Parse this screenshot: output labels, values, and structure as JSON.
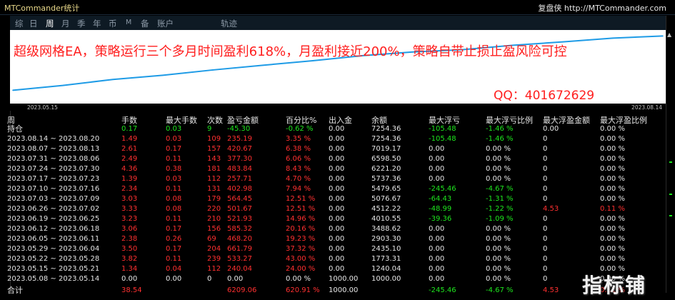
{
  "window": {
    "title": "MTCommander统计",
    "brand": "复盘侠 http://MTCommander.com"
  },
  "tabs": [
    "综",
    "日",
    "周",
    "月",
    "季",
    "年",
    "币",
    "M",
    "备",
    "账户",
    "轨迹"
  ],
  "active_tab": "周",
  "chart": {
    "headline": "超级网格EA，策略运行三个多月时间盈利618%，月盈利接近200%，策略自带止损止盈风险可控",
    "qq": "QQ：401672629",
    "start_date": "2023.05.15",
    "end_date": "2023.08.14",
    "line_color": "#1e9be6",
    "background": "#ffffff"
  },
  "chart_data": {
    "type": "line",
    "x": [
      "2023.05.15",
      "2023.05.22",
      "2023.05.29",
      "2023.06.05",
      "2023.06.12",
      "2023.06.19",
      "2023.06.26",
      "2023.07.03",
      "2023.07.10",
      "2023.07.17",
      "2023.07.24",
      "2023.07.31",
      "2023.08.07",
      "2023.08.14"
    ],
    "series": [
      {
        "values": [
          1240.04,
          1773.31,
          2435.1,
          2903.3,
          3488.62,
          4010.55,
          4512.22,
          5076.67,
          5479.65,
          5737.36,
          6221.2,
          6598.5,
          7019.17,
          7254.36
        ]
      }
    ]
  },
  "table": {
    "headers": [
      "周",
      "手数",
      "最大手数",
      "次数",
      "盈亏金额",
      "百分比%",
      "出入金",
      "余额",
      "最大浮亏",
      "最大浮亏比例",
      "最大浮盈金额",
      "最大浮盈比例"
    ],
    "holding_label": "持仓",
    "holding": [
      "0.17",
      "0.03",
      "9",
      "-45.30",
      "-0.62 %",
      "0.00",
      "7254.36",
      "-105.48",
      "-1.46 %",
      "0.00",
      "0.00 %"
    ],
    "rows": [
      [
        "2023.08.14 ~ 2023.08.20",
        "1.49",
        "0.03",
        "109",
        "235.19",
        "3.35 %",
        "0.00",
        "7254.36",
        "-105.48",
        "-1.46 %",
        "0",
        "0.00 %"
      ],
      [
        "2023.08.07 ~ 2023.08.13",
        "2.61",
        "0.17",
        "157",
        "420.67",
        "6.38 %",
        "0.00",
        "7019.17",
        "0.00",
        "0.00 %",
        "0",
        "0.00 %"
      ],
      [
        "2023.07.31 ~ 2023.08.06",
        "2.49",
        "0.11",
        "143",
        "377.30",
        "6.06 %",
        "0.00",
        "6598.50",
        "0.00",
        "0.00 %",
        "0",
        "0.00 %"
      ],
      [
        "2023.07.24 ~ 2023.07.30",
        "4.36",
        "0.38",
        "181",
        "483.84",
        "8.43 %",
        "0.00",
        "6221.20",
        "0.00",
        "0.00 %",
        "0",
        "0.00 %"
      ],
      [
        "2023.07.17 ~ 2023.07.23",
        "1.39",
        "0.03",
        "112",
        "257.71",
        "4.70 %",
        "0.00",
        "5737.36",
        "0.00",
        "0.00 %",
        "0",
        "0.00 %"
      ],
      [
        "2023.07.10 ~ 2023.07.16",
        "2.34",
        "0.11",
        "131",
        "402.98",
        "7.94 %",
        "0.00",
        "5479.65",
        "-245.46",
        "-4.67 %",
        "0",
        "0.00 %"
      ],
      [
        "2023.07.03 ~ 2023.07.09",
        "3.03",
        "0.08",
        "179",
        "564.45",
        "12.51 %",
        "0.00",
        "5076.67",
        "-64.43",
        "-1.31 %",
        "0",
        "0.00 %"
      ],
      [
        "2023.06.26 ~ 2023.07.02",
        "3.33",
        "0.08",
        "220",
        "501.67",
        "12.51 %",
        "0.00",
        "4512.22",
        "-48.99",
        "-1.22 %",
        "4.53",
        "0.11 %"
      ],
      [
        "2023.06.19 ~ 2023.06.25",
        "3.23",
        "0.11",
        "210",
        "521.93",
        "14.96 %",
        "0.00",
        "4010.55",
        "-39.36",
        "-1.09 %",
        "0",
        "0.00 %"
      ],
      [
        "2023.06.12 ~ 2023.06.18",
        "3.06",
        "0.17",
        "156",
        "585.32",
        "20.16 %",
        "0.00",
        "3488.62",
        "0.00",
        "0.00 %",
        "0",
        "0.00 %"
      ],
      [
        "2023.06.05 ~ 2023.06.11",
        "2.38",
        "0.26",
        "69",
        "468.20",
        "19.23 %",
        "0.00",
        "2903.30",
        "0.00",
        "0.00 %",
        "0",
        "0.00 %"
      ],
      [
        "2023.05.29 ~ 2023.06.04",
        "3.50",
        "0.17",
        "204",
        "661.79",
        "37.32 %",
        "0.00",
        "2435.10",
        "0.00",
        "0.00 %",
        "0",
        "0.00 %"
      ],
      [
        "2023.05.22 ~ 2023.05.28",
        "3.82",
        "0.11",
        "239",
        "533.27",
        "43.00 %",
        "0.00",
        "1773.31",
        "0.00",
        "0.00 %",
        "0",
        "0.00 %"
      ],
      [
        "2023.05.15 ~ 2023.05.21",
        "1.34",
        "0.04",
        "112",
        "240.04",
        "24.00 %",
        "0.00",
        "1240.04",
        "0.00",
        "0.00 %",
        "0",
        "0.00 %"
      ],
      [
        "2023.05.08 ~ 2023.05.14",
        "0.00",
        "0.00",
        "0",
        "0.00",
        "0.00 %",
        "1000.00",
        "1000.00",
        "0.00",
        "0.00 %",
        "0",
        "0.00 %"
      ]
    ],
    "total_label": "合计",
    "total": [
      "38.54",
      "",
      "",
      "6209.06",
      "620.91 %",
      "1000.00",
      "",
      "-245.46",
      "-4.67 %",
      "4.53",
      "0.11 %"
    ]
  },
  "watermark": "指标铺",
  "colors": {
    "background": "#000000",
    "profit": "#ff3030",
    "loss": "#1ee61e",
    "text": "#e6e6e6",
    "title": "#e8d88a"
  }
}
